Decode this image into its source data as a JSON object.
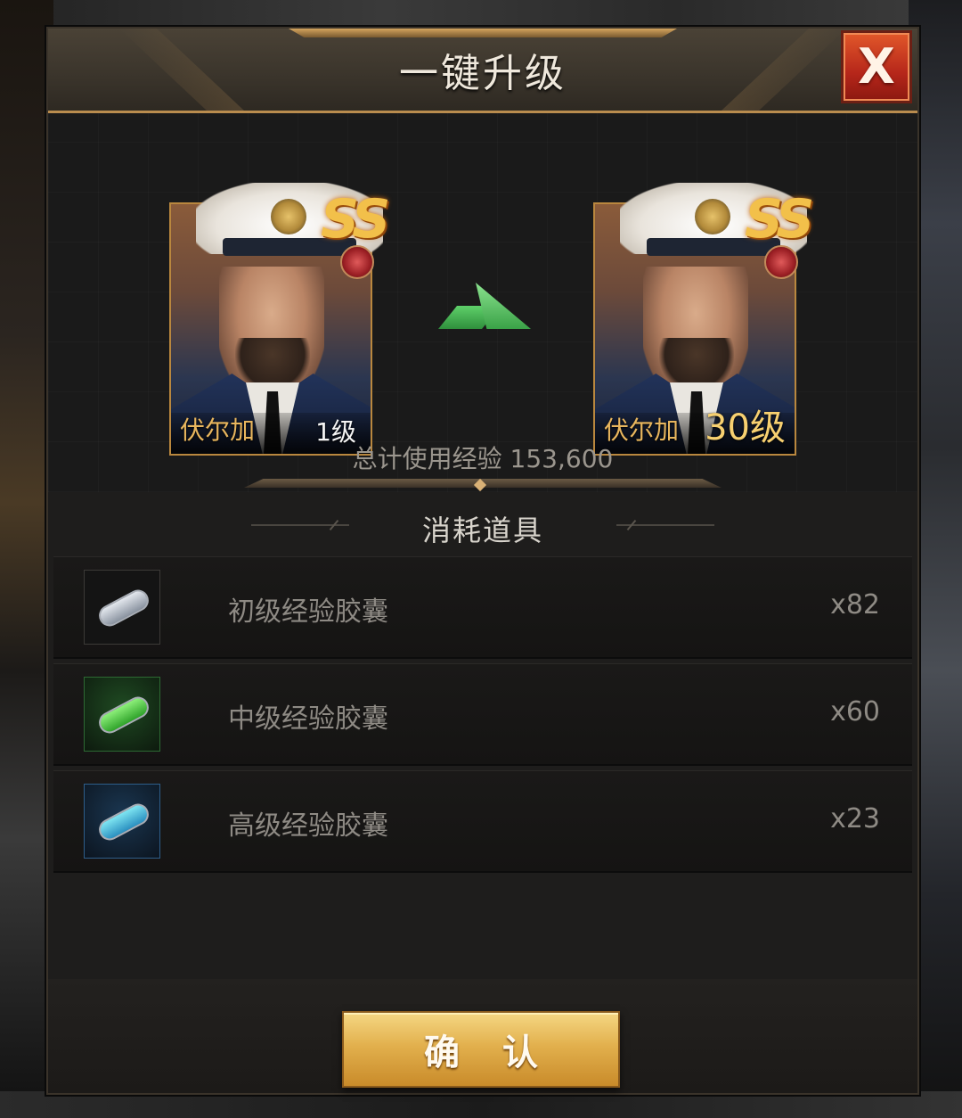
{
  "dialog": {
    "title": "一键升级",
    "close_label": "X"
  },
  "hero_before": {
    "name": "伏尔加",
    "level": "1级",
    "grade": "SS"
  },
  "hero_after": {
    "name": "伏尔加",
    "level": "30级",
    "grade": "SS"
  },
  "exp_summary": "总计使用经验 153,600",
  "consumables": {
    "title": "消耗道具",
    "items": [
      {
        "name": "初级经验胶囊",
        "count": "x82"
      },
      {
        "name": "中级经验胶囊",
        "count": "x60"
      },
      {
        "name": "高级经验胶囊",
        "count": "x23"
      }
    ]
  },
  "confirm_label": "确认",
  "icons": {
    "close": "close-icon",
    "arrow": "arrow-right-icon",
    "capsule": "exp-capsule-icon",
    "rank": "rank-badge-icon"
  }
}
